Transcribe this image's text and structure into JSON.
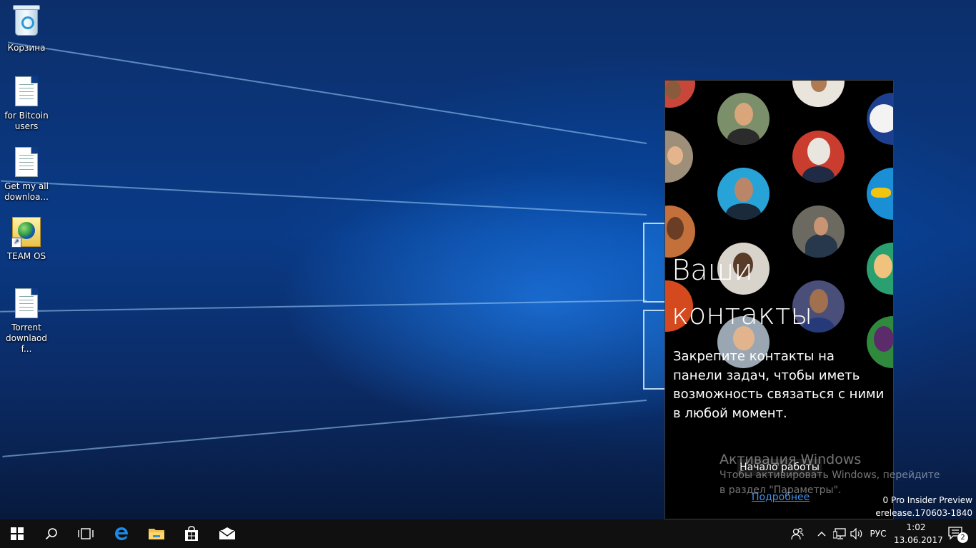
{
  "desktop": {
    "icons": [
      {
        "label": "Корзина",
        "icon": "recycle-bin-icon"
      },
      {
        "label": "for Bitcoin users",
        "icon": "text-file-icon"
      },
      {
        "label": "Get my all downloa...",
        "icon": "text-file-icon"
      },
      {
        "label": "TEAM OS",
        "icon": "web-shortcut-icon"
      },
      {
        "label": "Torrent downlaod f...",
        "icon": "text-file-icon"
      }
    ]
  },
  "people_panel": {
    "title_line1": "Ваши",
    "title_line2": "контакты",
    "description": "Закрепите контакты на панели задач, чтобы иметь возможность связаться с ними в любой момент.",
    "start_button": "Начало работы",
    "more_link": "Подробнее"
  },
  "activation": {
    "title": "Активация Windows",
    "text": "Чтобы активировать Windows, перейдите в раздел \"Параметры\"."
  },
  "build_info": {
    "line1": "0 Pro Insider Preview",
    "line2": "erelease.170603-1840"
  },
  "taskbar": {
    "apps": [
      "start-icon",
      "search-icon",
      "task-view-icon",
      "edge-icon",
      "file-explorer-icon",
      "store-icon",
      "mail-icon"
    ],
    "tray": {
      "language": "РУС",
      "time": "1:02",
      "date": "13.06.2017",
      "notification_count": "2"
    }
  },
  "colors": {
    "taskbar": "#101010",
    "panel": "#000000",
    "link": "#3e8fe8",
    "accent": "#0078d7"
  }
}
